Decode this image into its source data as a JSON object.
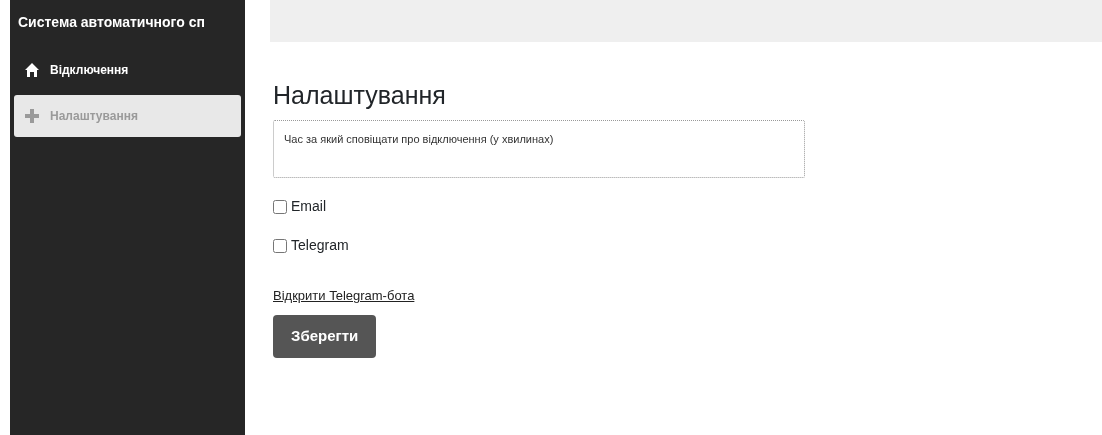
{
  "sidebar": {
    "title": "Система автоматичного сп",
    "items": [
      {
        "label": "Відключення",
        "kind": "home",
        "selected": false
      },
      {
        "label": "Налаштування",
        "kind": "add",
        "selected": true
      }
    ]
  },
  "main": {
    "heading": "Налаштування",
    "field": {
      "placeholder": "Час за який сповіщати про відключення (у хвилинах)"
    },
    "checkboxes": [
      {
        "label": "Email",
        "checked": false
      },
      {
        "label": "Telegram",
        "checked": false
      }
    ],
    "link": "Відкрити Telegram-бота",
    "button": "Зберегти"
  }
}
